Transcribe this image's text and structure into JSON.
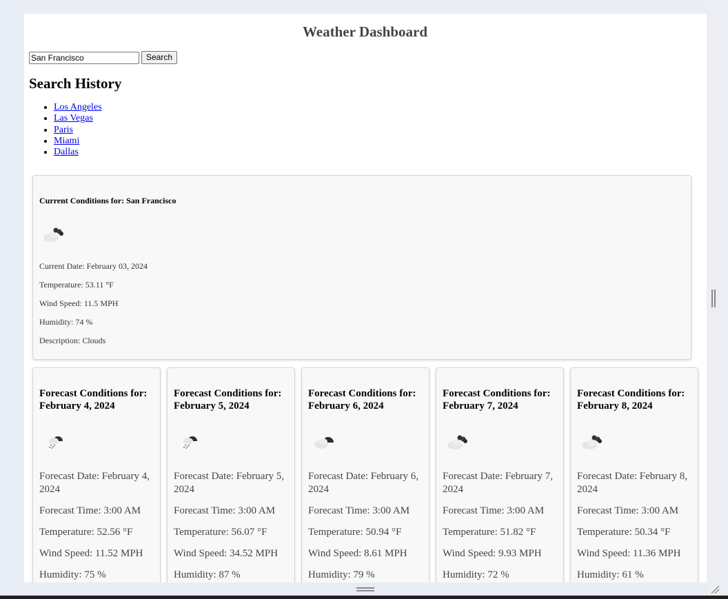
{
  "app": {
    "title": "Weather Dashboard"
  },
  "search": {
    "value": "San Francisco",
    "button_label": "Search"
  },
  "history": {
    "title": "Search History",
    "items": [
      "Los Angeles",
      "Las Vegas",
      "Paris",
      "Miami",
      "Dallas"
    ]
  },
  "current": {
    "title": "Current Conditions for: San Francisco",
    "icon": "broken-clouds-icon",
    "date": "Current Date: February 03, 2024",
    "temperature": "Temperature: 53.11 °F",
    "wind": "Wind Speed: 11.5 MPH",
    "humidity": "Humidity: 74 %",
    "description": "Description: Clouds"
  },
  "forecast": [
    {
      "title": "Forecast Conditions for: February 4, 2024",
      "icon": "rain-icon",
      "date": "Forecast Date: February 4, 2024",
      "time": "Forecast Time: 3:00 AM",
      "temperature": "Temperature: 52.56 °F",
      "wind": "Wind Speed: 11.52 MPH",
      "humidity": "Humidity: 75 %"
    },
    {
      "title": "Forecast Conditions for: February 5, 2024",
      "icon": "rain-icon",
      "date": "Forecast Date: February 5, 2024",
      "time": "Forecast Time: 3:00 AM",
      "temperature": "Temperature: 56.07 °F",
      "wind": "Wind Speed: 34.52 MPH",
      "humidity": "Humidity: 87 %"
    },
    {
      "title": "Forecast Conditions for: February 6, 2024",
      "icon": "overcast-clouds-icon",
      "date": "Forecast Date: February 6, 2024",
      "time": "Forecast Time: 3:00 AM",
      "temperature": "Temperature: 50.94 °F",
      "wind": "Wind Speed: 8.61 MPH",
      "humidity": "Humidity: 79 %"
    },
    {
      "title": "Forecast Conditions for: February 7, 2024",
      "icon": "broken-clouds-icon",
      "date": "Forecast Date: February 7, 2024",
      "time": "Forecast Time: 3:00 AM",
      "temperature": "Temperature: 51.82 °F",
      "wind": "Wind Speed: 9.93 MPH",
      "humidity": "Humidity: 72 %"
    },
    {
      "title": "Forecast Conditions for: February 8, 2024",
      "icon": "broken-clouds-icon",
      "date": "Forecast Date: February 8, 2024",
      "time": "Forecast Time: 3:00 AM",
      "temperature": "Temperature: 50.34 °F",
      "wind": "Wind Speed: 11.36 MPH",
      "humidity": "Humidity: 61 %"
    }
  ],
  "colors": {
    "card_bg": "#f8f8f8",
    "link": "#0000ee",
    "title": "#444444"
  }
}
